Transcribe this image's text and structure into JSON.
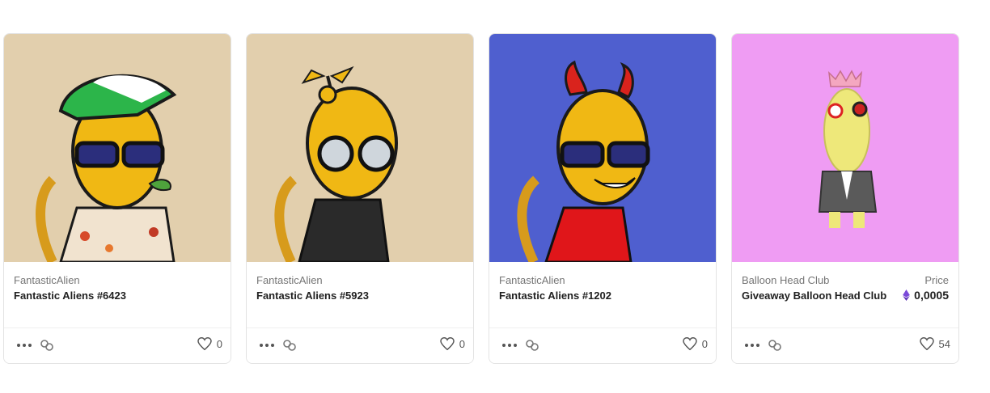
{
  "cards": [
    {
      "collection": "FantasticAlien",
      "title": "Fantastic Aliens #6423",
      "likes": "0",
      "bg": "#e2cfad"
    },
    {
      "collection": "FantasticAlien",
      "title": "Fantastic Aliens #5923",
      "likes": "0",
      "bg": "#e2cfad"
    },
    {
      "collection": "FantasticAlien",
      "title": "Fantastic Aliens #1202",
      "likes": "0",
      "bg": "#4f5fcf"
    },
    {
      "collection": "Balloon Head Club",
      "title": "Giveaway Balloon Head Club",
      "price_label": "Price",
      "price": "0,0005",
      "likes": "54",
      "bg": "#ef9cf3"
    }
  ],
  "icons": {
    "more": "more-dots-icon",
    "link": "link-icon",
    "like": "heart-icon",
    "currency": "ethereum-icon"
  }
}
